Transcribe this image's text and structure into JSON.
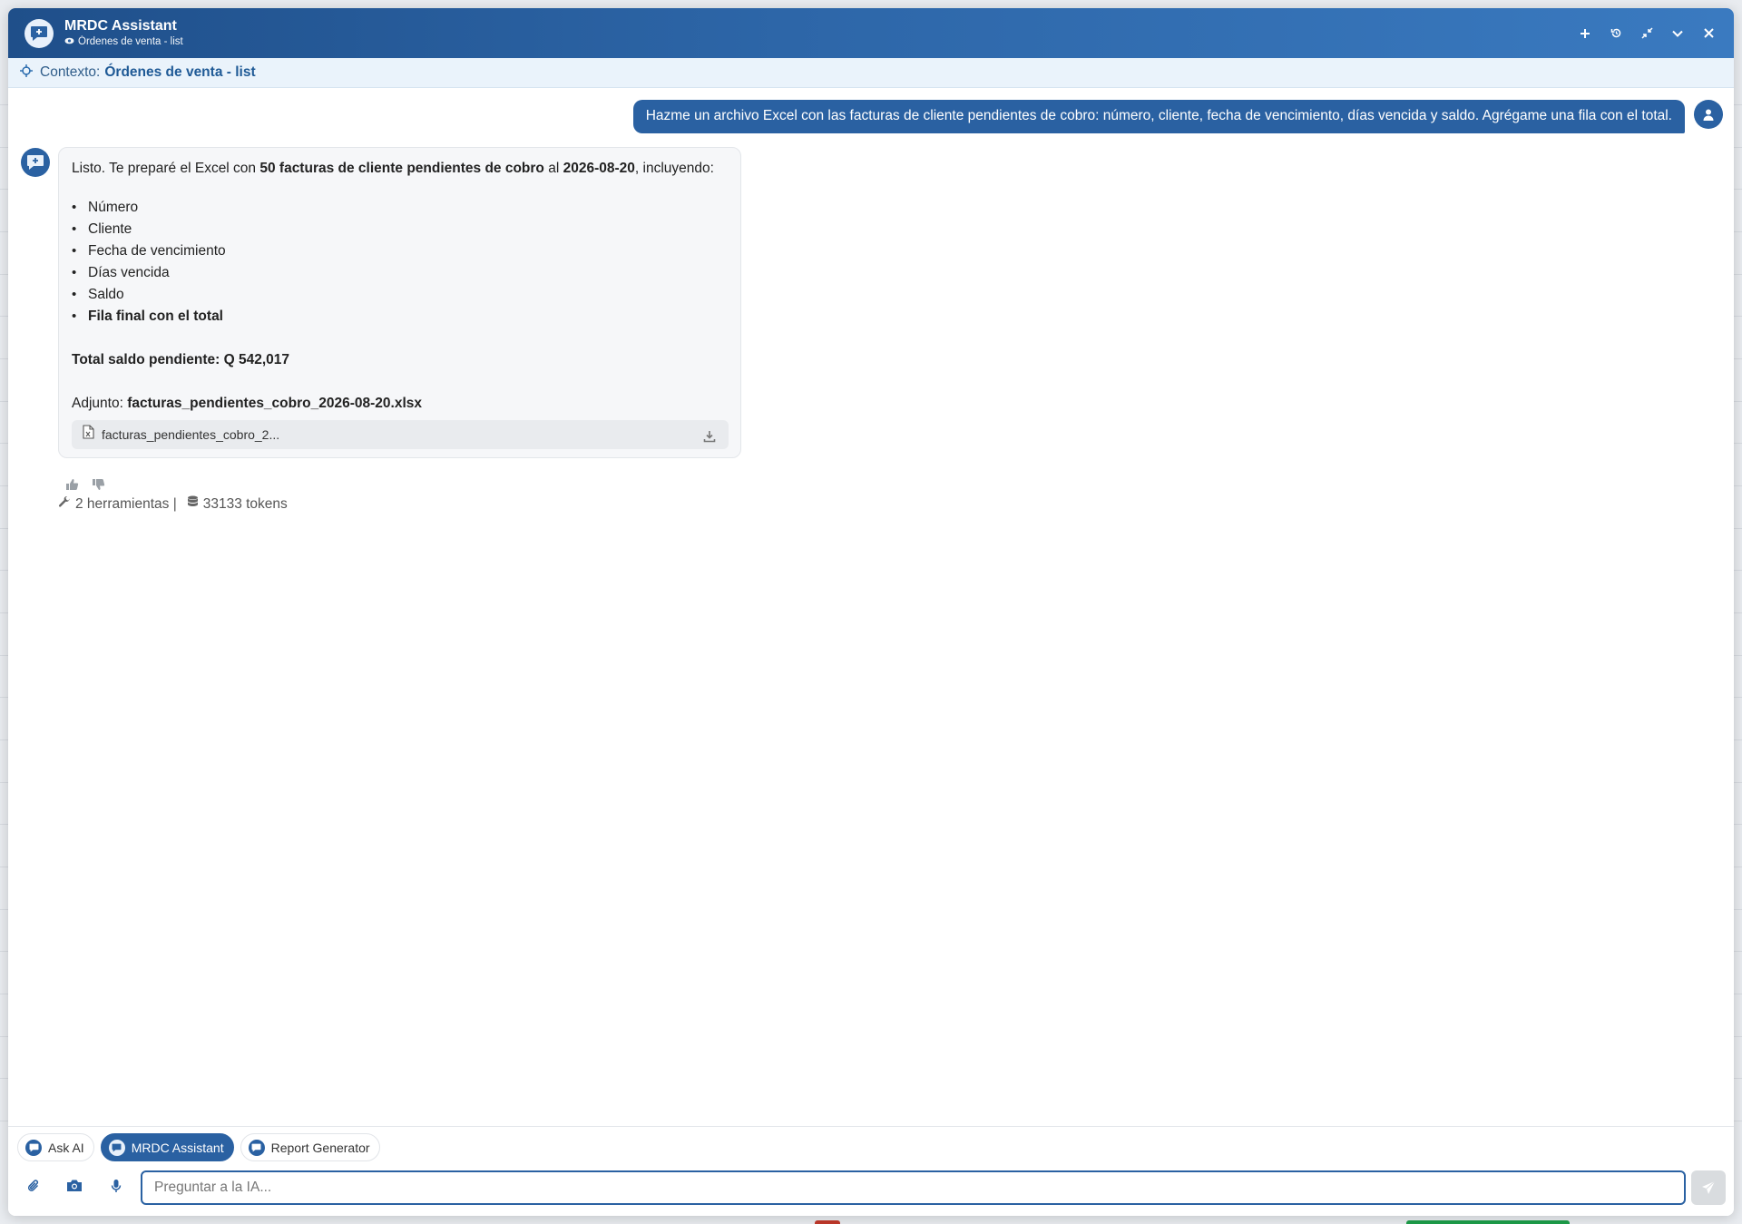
{
  "window": {
    "title": "MRDC Assistant",
    "subtitle": "Órdenes de venta - list"
  },
  "context": {
    "label": "Contexto:",
    "value": "Órdenes de venta - list"
  },
  "user_message": {
    "text": "Hazme un archivo Excel con las facturas de cliente pendientes de cobro: número, cliente, fecha de vencimiento, días vencida y saldo. Agrégame una fila con el total."
  },
  "assistant_message": {
    "intro_prefix": "Listo. Te preparé el Excel con ",
    "intro_bold": "50 facturas de cliente pendientes de cobro",
    "intro_mid": " al ",
    "intro_date": "2026-08-20",
    "intro_suffix": ", incluyendo:",
    "items": [
      "Número",
      "Cliente",
      "Fecha de vencimiento",
      "Días vencida",
      "Saldo"
    ],
    "last_item_bold": "Fila final con el total",
    "total": "Total saldo pendiente: Q 542,017",
    "adjunto_label": "Adjunto: ",
    "adjunto_file": "facturas_pendientes_cobro_2026-08-20.xlsx",
    "file_chip_name": "facturas_pendientes_cobro_2..."
  },
  "meta": {
    "tools": "2 herramientas |",
    "tokens": "33133 tokens"
  },
  "agent_tabs": [
    {
      "label": "Ask AI",
      "active": false
    },
    {
      "label": "MRDC Assistant",
      "active": true
    },
    {
      "label": "Report Generator",
      "active": false
    }
  ],
  "input": {
    "placeholder": "Preguntar a la IA..."
  },
  "colors": {
    "primary": "#2a61a2",
    "header_start": "#1f4f8a",
    "header_end": "#3a7ac0",
    "context_bg": "#eaf3fb"
  }
}
